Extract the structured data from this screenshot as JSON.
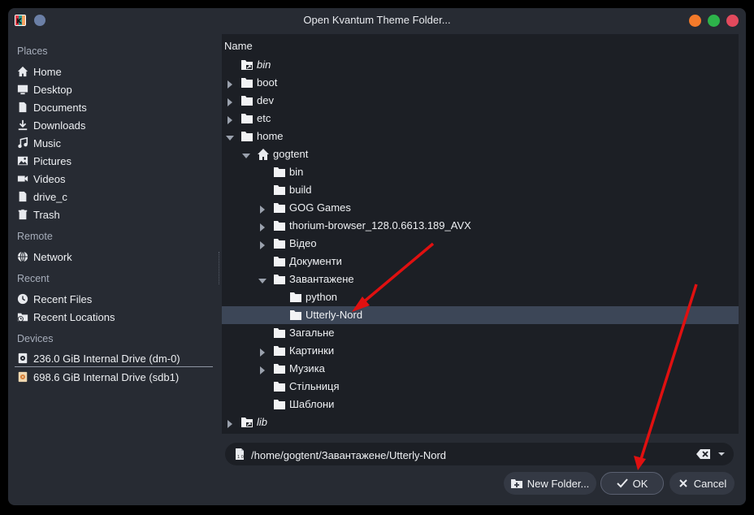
{
  "window": {
    "title": "Open Kvantum Theme Folder..."
  },
  "sidebar": {
    "sections": [
      {
        "title": "Places",
        "items": [
          {
            "label": "Home",
            "icon": "home-icon"
          },
          {
            "label": "Desktop",
            "icon": "desktop-icon"
          },
          {
            "label": "Documents",
            "icon": "document-icon"
          },
          {
            "label": "Downloads",
            "icon": "download-icon"
          },
          {
            "label": "Music",
            "icon": "music-icon"
          },
          {
            "label": "Pictures",
            "icon": "picture-icon"
          },
          {
            "label": "Videos",
            "icon": "video-icon"
          },
          {
            "label": "drive_c",
            "icon": "file-icon"
          },
          {
            "label": "Trash",
            "icon": "trash-icon"
          }
        ]
      },
      {
        "title": "Remote",
        "items": [
          {
            "label": "Network",
            "icon": "network-icon"
          }
        ]
      },
      {
        "title": "Recent",
        "items": [
          {
            "label": "Recent Files",
            "icon": "clock-icon"
          },
          {
            "label": "Recent Locations",
            "icon": "recent-folder-icon"
          }
        ]
      },
      {
        "title": "Devices",
        "items": [
          {
            "label": "236.0 GiB Internal Drive (dm-0)",
            "icon": "drive-icon"
          },
          {
            "label": "698.6 GiB Internal Drive (sdb1)",
            "icon": "drive-orange-icon"
          }
        ]
      }
    ]
  },
  "tree": {
    "column_header": "Name",
    "rows": [
      {
        "label": "bin",
        "depth": 0,
        "expander": "none",
        "icon": "folder-link-icon",
        "italic": true,
        "selected": false
      },
      {
        "label": "boot",
        "depth": 0,
        "expander": "collapsed",
        "icon": "folder-icon",
        "italic": false,
        "selected": false
      },
      {
        "label": "dev",
        "depth": 0,
        "expander": "collapsed",
        "icon": "folder-icon",
        "italic": false,
        "selected": false
      },
      {
        "label": "etc",
        "depth": 0,
        "expander": "collapsed",
        "icon": "folder-icon",
        "italic": false,
        "selected": false
      },
      {
        "label": "home",
        "depth": 0,
        "expander": "expanded",
        "icon": "folder-icon",
        "italic": false,
        "selected": false
      },
      {
        "label": "gogtent",
        "depth": 1,
        "expander": "expanded",
        "icon": "home-icon",
        "italic": false,
        "selected": false
      },
      {
        "label": "bin",
        "depth": 2,
        "expander": "none",
        "icon": "folder-icon",
        "italic": false,
        "selected": false
      },
      {
        "label": "build",
        "depth": 2,
        "expander": "none",
        "icon": "folder-icon",
        "italic": false,
        "selected": false
      },
      {
        "label": "GOG Games",
        "depth": 2,
        "expander": "collapsed",
        "icon": "folder-icon",
        "italic": false,
        "selected": false
      },
      {
        "label": "thorium-browser_128.0.6613.189_AVX",
        "depth": 2,
        "expander": "collapsed",
        "icon": "folder-icon",
        "italic": false,
        "selected": false
      },
      {
        "label": "Відео",
        "depth": 2,
        "expander": "collapsed",
        "icon": "folder-icon",
        "italic": false,
        "selected": false
      },
      {
        "label": "Документи",
        "depth": 2,
        "expander": "none",
        "icon": "folder-icon",
        "italic": false,
        "selected": false
      },
      {
        "label": "Завантажене",
        "depth": 2,
        "expander": "expanded",
        "icon": "folder-icon",
        "italic": false,
        "selected": false
      },
      {
        "label": "python",
        "depth": 3,
        "expander": "none",
        "icon": "folder-icon",
        "italic": false,
        "selected": false
      },
      {
        "label": "Utterly-Nord",
        "depth": 3,
        "expander": "none",
        "icon": "folder-icon",
        "italic": false,
        "selected": true
      },
      {
        "label": "Загальне",
        "depth": 2,
        "expander": "none",
        "icon": "folder-icon",
        "italic": false,
        "selected": false
      },
      {
        "label": "Картинки",
        "depth": 2,
        "expander": "collapsed",
        "icon": "folder-icon",
        "italic": false,
        "selected": false
      },
      {
        "label": "Музика",
        "depth": 2,
        "expander": "collapsed",
        "icon": "folder-icon",
        "italic": false,
        "selected": false
      },
      {
        "label": "Стільниця",
        "depth": 2,
        "expander": "none",
        "icon": "folder-icon",
        "italic": false,
        "selected": false
      },
      {
        "label": "Шаблони",
        "depth": 2,
        "expander": "none",
        "icon": "folder-icon",
        "italic": false,
        "selected": false
      },
      {
        "label": "lib",
        "depth": 0,
        "expander": "collapsed",
        "icon": "folder-link-icon",
        "italic": true,
        "selected": false
      }
    ]
  },
  "location": {
    "value": "/home/gogtent/Завантажене/Utterly-Nord"
  },
  "buttons": {
    "new_folder": "New Folder...",
    "ok": "OK",
    "cancel": "Cancel"
  },
  "colors": {
    "window_bg": "#272b33",
    "pane_bg": "#1c1f25",
    "selection": "#3c4657",
    "annotation_arrow": "#e01010",
    "close": "#e24a5d",
    "maximize": "#2db34a",
    "minimize": "#f37a2a"
  }
}
